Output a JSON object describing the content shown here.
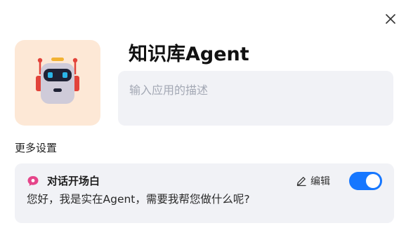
{
  "dialog": {
    "title": "知识库Agent",
    "description": {
      "value": "",
      "placeholder": "输入应用的描述"
    },
    "avatar_icon": "robot-icon",
    "close_icon": "close-icon"
  },
  "settings": {
    "section_label": "更多设置",
    "opener": {
      "icon": "chat-bubble-icon",
      "title": "对话开场白",
      "text": "您好，我是实在Agent，需要我帮您做什么呢?",
      "edit_label": "编辑",
      "edit_icon": "pencil-icon",
      "toggle_on": true
    }
  },
  "colors": {
    "accent": "#1677ff",
    "avatar_bg": "#fde8d6",
    "field_bg": "#f1f2f6",
    "chat_icon": "#e5458a",
    "robot_red": "#e2433a"
  }
}
